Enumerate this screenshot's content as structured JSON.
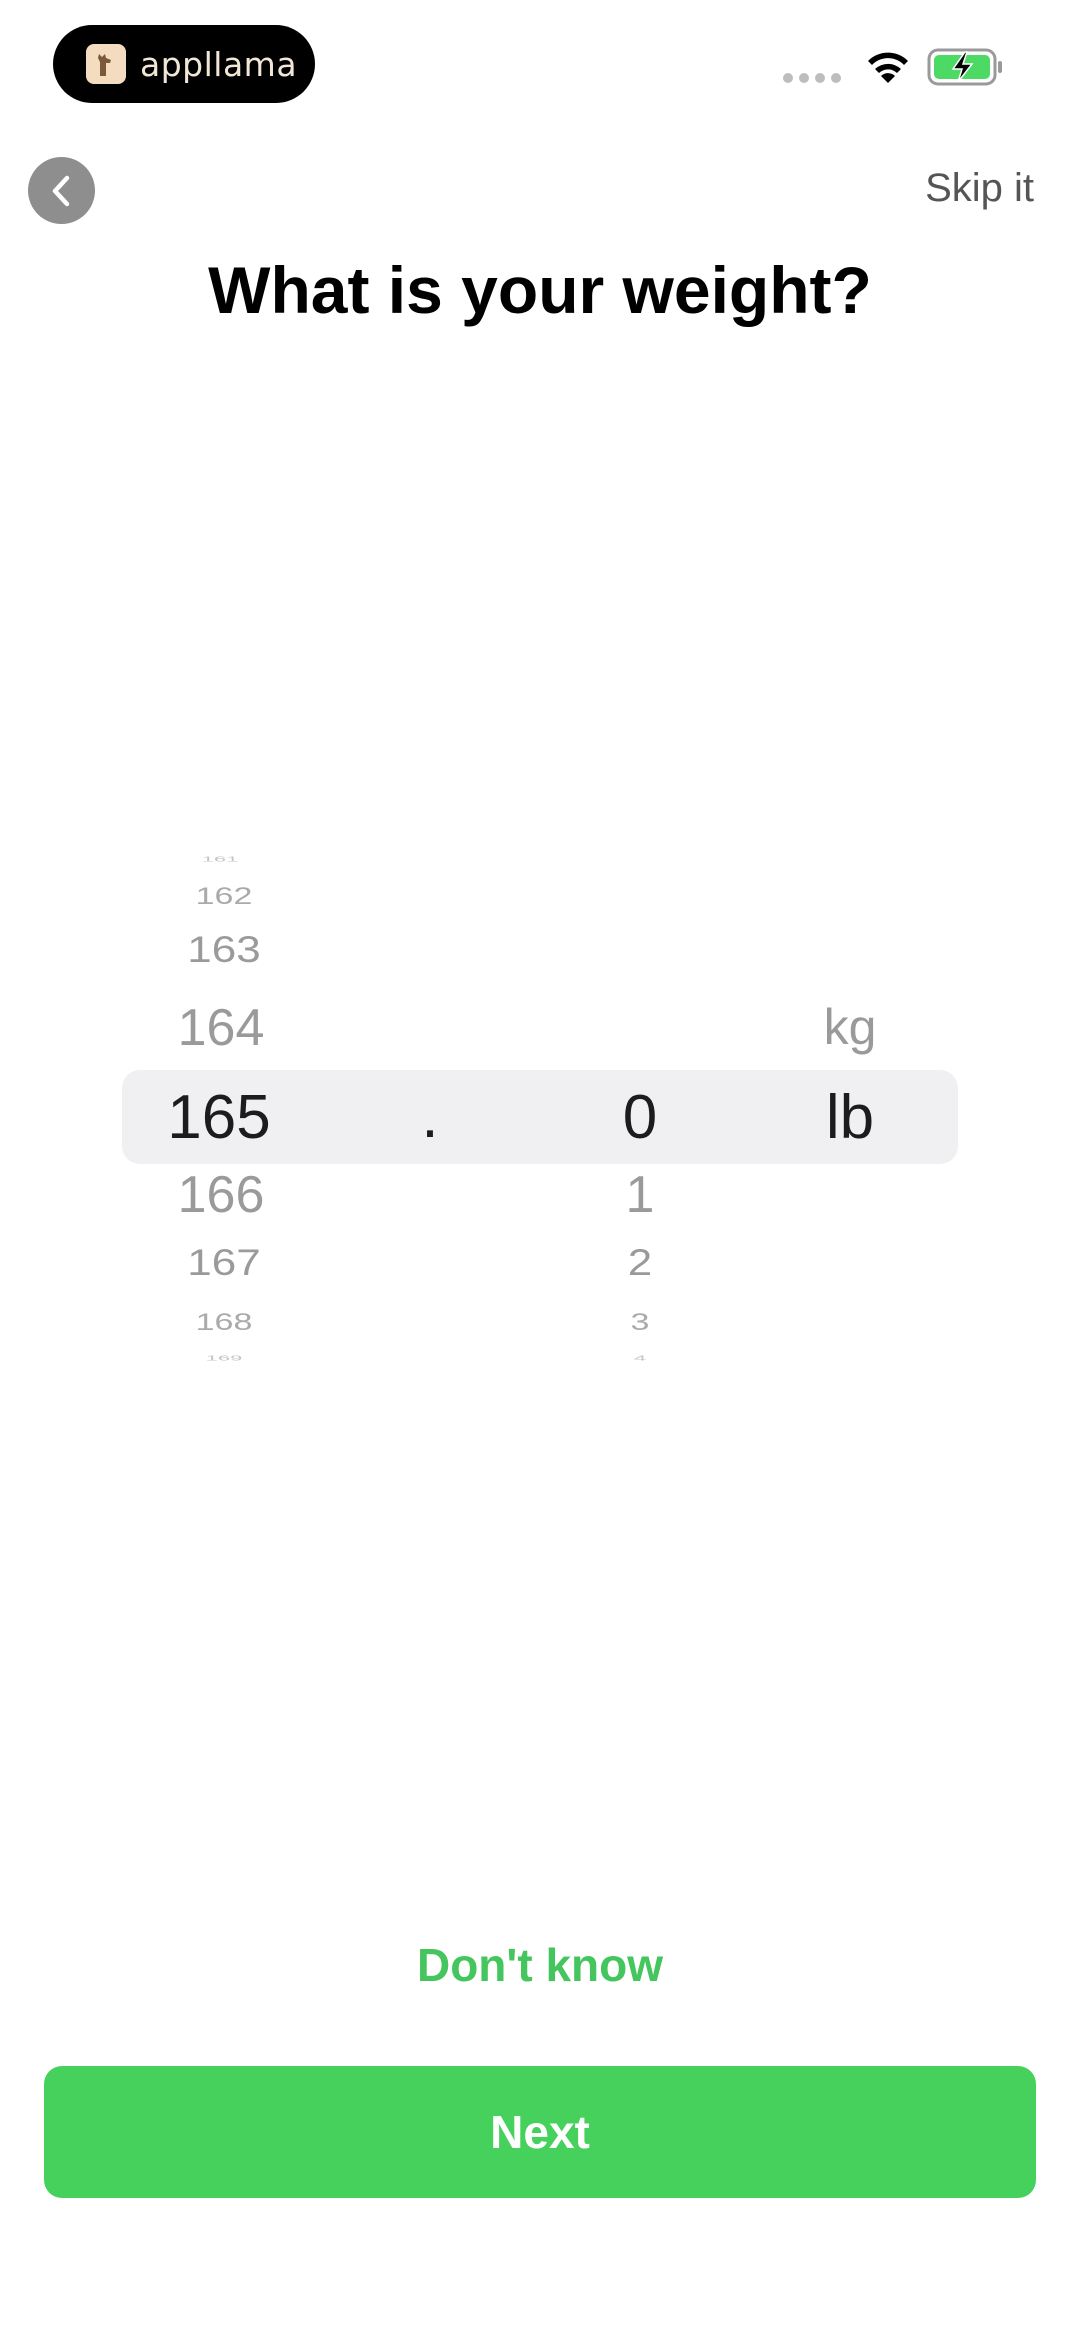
{
  "status_bar": {
    "app_pill_label": "appllama",
    "signal_icon": "cellular-dots",
    "wifi_icon": "wifi-icon",
    "battery_icon": "battery-charging-icon",
    "battery_color": "#4cd964"
  },
  "nav": {
    "back_icon": "chevron-left-icon",
    "skip_label": "Skip it"
  },
  "title": "What is your weight?",
  "picker": {
    "integer_column": {
      "above": [
        "161",
        "162",
        "163",
        "164"
      ],
      "selected": "165",
      "below": [
        "166",
        "167",
        "168",
        "169"
      ]
    },
    "separator": ".",
    "decimal_column": {
      "above": [],
      "selected": "0",
      "below": [
        "1",
        "2",
        "3",
        "4"
      ]
    },
    "unit_column": {
      "above": [
        "kg"
      ],
      "selected": "lb",
      "below": []
    }
  },
  "dont_know_label": "Don't know",
  "next_label": "Next",
  "colors": {
    "accent_green": "#45d15b",
    "dont_know_green": "#45c55d",
    "highlight_bg": "#f0f0f2"
  }
}
